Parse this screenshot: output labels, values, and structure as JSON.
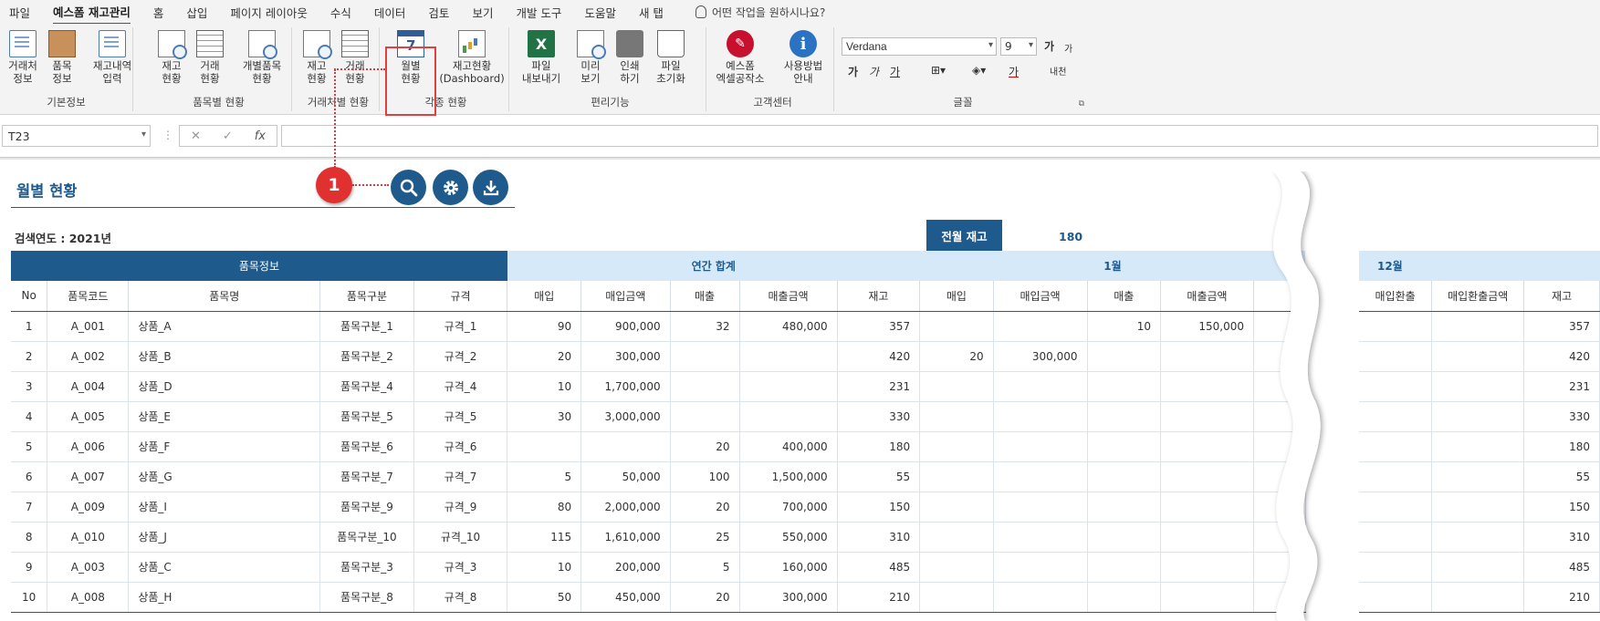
{
  "menu": {
    "tabs": [
      "파일",
      "예스폼 재고관리",
      "홈",
      "삽입",
      "페이지 레이아웃",
      "수식",
      "데이터",
      "검토",
      "보기",
      "개발 도구",
      "도움말",
      "새 탭"
    ],
    "active_index": 1,
    "help_text": "어떤 작업을 원하시나요?"
  },
  "ribbon": {
    "groups": {
      "basic": "기본정보",
      "item": "품목별 현황",
      "partner": "거래처별 현황",
      "various": "각종 현황",
      "convenience": "편리기능",
      "support": "고객센터",
      "font": "글꼴"
    },
    "buttons": {
      "partner_info": [
        "거래처",
        "정보"
      ],
      "item_info": [
        "품목",
        "정보"
      ],
      "stock_entry": [
        "재고내역",
        "입력"
      ],
      "stock_status": [
        "재고",
        "현황"
      ],
      "trade_status": [
        "거래",
        "현황"
      ],
      "item_detail": [
        "개별품목",
        "현황"
      ],
      "p_stock_status": [
        "재고",
        "현황"
      ],
      "p_trade_status": [
        "거래",
        "현황"
      ],
      "monthly": [
        "월별",
        "현황"
      ],
      "dashboard": [
        "재고현황",
        "(Dashboard)"
      ],
      "export": [
        "파일",
        "내보내기"
      ],
      "preview": [
        "미리",
        "보기"
      ],
      "print": [
        "인쇄",
        "하기"
      ],
      "reset": [
        "파일",
        "초기화"
      ],
      "yesform": [
        "예스폼",
        "엑셀공작소"
      ],
      "guide": [
        "사용방법",
        "안내"
      ]
    },
    "font_name": "Verdana",
    "font_size": "9",
    "font_grow": "가",
    "font_shrink": "가",
    "bold": "가",
    "italic": "가",
    "underline": "가",
    "font_color": "가",
    "phonetic": "내천"
  },
  "formula": {
    "name_box": "T23",
    "value": ""
  },
  "sheet": {
    "title": "월별 현황",
    "badge": "1",
    "search_year": "검색연도 : 2021년",
    "prev_stock_label": "전월 재고",
    "prev_stock_value": "180",
    "header_groups": {
      "item_info": "품목정보",
      "annual": "연간 합계",
      "jan": "1월",
      "dec": "12월"
    },
    "columns": {
      "no": "No",
      "code": "품목코드",
      "name": "품목명",
      "category": "품목구분",
      "spec": "규격",
      "annual": [
        "매입",
        "매입금액",
        "매출",
        "매출금액",
        "재고"
      ],
      "jan": [
        "매입",
        "매입금액",
        "매출",
        "매출금액"
      ],
      "dec": [
        "매입환출",
        "매입환출금액",
        "재고"
      ]
    },
    "rows": [
      {
        "no": "1",
        "code": "A_001",
        "name": "상품_A",
        "cat": "품목구분_1",
        "spec": "규격_1",
        "a": [
          "90",
          "900,000",
          "32",
          "480,000",
          "357"
        ],
        "j": [
          "",
          "",
          "10",
          "150,000"
        ],
        "d": [
          "",
          "",
          "357"
        ]
      },
      {
        "no": "2",
        "code": "A_002",
        "name": "상품_B",
        "cat": "품목구분_2",
        "spec": "규격_2",
        "a": [
          "20",
          "300,000",
          "",
          "",
          "420"
        ],
        "j": [
          "20",
          "300,000",
          "",
          ""
        ],
        "d": [
          "",
          "",
          "420"
        ]
      },
      {
        "no": "3",
        "code": "A_004",
        "name": "상품_D",
        "cat": "품목구분_4",
        "spec": "규격_4",
        "a": [
          "10",
          "1,700,000",
          "",
          "",
          "231"
        ],
        "j": [
          "",
          "",
          "",
          ""
        ],
        "d": [
          "",
          "",
          "231"
        ]
      },
      {
        "no": "4",
        "code": "A_005",
        "name": "상품_E",
        "cat": "품목구분_5",
        "spec": "규격_5",
        "a": [
          "30",
          "3,000,000",
          "",
          "",
          "330"
        ],
        "j": [
          "",
          "",
          "",
          ""
        ],
        "d": [
          "",
          "",
          "330"
        ]
      },
      {
        "no": "5",
        "code": "A_006",
        "name": "상품_F",
        "cat": "품목구분_6",
        "spec": "규격_6",
        "a": [
          "",
          "",
          "20",
          "400,000",
          "180"
        ],
        "j": [
          "",
          "",
          "",
          ""
        ],
        "d": [
          "",
          "",
          "180"
        ]
      },
      {
        "no": "6",
        "code": "A_007",
        "name": "상품_G",
        "cat": "품목구분_7",
        "spec": "규격_7",
        "a": [
          "5",
          "50,000",
          "100",
          "1,500,000",
          "55"
        ],
        "j": [
          "",
          "",
          "",
          ""
        ],
        "d": [
          "",
          "",
          "55"
        ]
      },
      {
        "no": "7",
        "code": "A_009",
        "name": "상품_I",
        "cat": "품목구분_9",
        "spec": "규격_9",
        "a": [
          "80",
          "2,000,000",
          "20",
          "700,000",
          "150"
        ],
        "j": [
          "",
          "",
          "",
          ""
        ],
        "d": [
          "",
          "",
          "150"
        ]
      },
      {
        "no": "8",
        "code": "A_010",
        "name": "상품_J",
        "cat": "품목구분_10",
        "spec": "규격_10",
        "a": [
          "115",
          "1,610,000",
          "25",
          "550,000",
          "310"
        ],
        "j": [
          "",
          "",
          "",
          ""
        ],
        "d": [
          "",
          "",
          "310"
        ]
      },
      {
        "no": "9",
        "code": "A_003",
        "name": "상품_C",
        "cat": "품목구분_3",
        "spec": "규격_3",
        "a": [
          "10",
          "200,000",
          "5",
          "160,000",
          "485"
        ],
        "j": [
          "",
          "",
          "",
          ""
        ],
        "d": [
          "",
          "",
          "485"
        ]
      },
      {
        "no": "10",
        "code": "A_008",
        "name": "상품_H",
        "cat": "품목구분_8",
        "spec": "규격_8",
        "a": [
          "50",
          "450,000",
          "20",
          "300,000",
          "210"
        ],
        "j": [
          "",
          "",
          "",
          ""
        ],
        "d": [
          "",
          "",
          "210"
        ]
      }
    ]
  },
  "colors": {
    "brand_dark": "#1f5a8c",
    "brand_light": "#d6e9f8",
    "badge_red": "#e03030",
    "excel_green": "#217346"
  }
}
